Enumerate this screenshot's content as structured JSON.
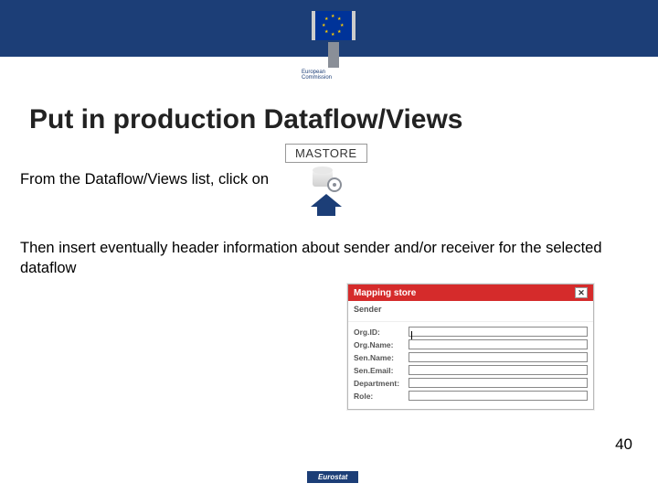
{
  "logo": {
    "line1": "European",
    "line2": "Commission"
  },
  "headline": "Put in production Dataflow/Views",
  "line1": "From the Dataflow/Views list, click on",
  "mastore": {
    "label": "MASTORE"
  },
  "line2": "Then insert eventually header information about sender and/or receiver for the selected dataflow",
  "dialog": {
    "title": "Mapping store",
    "section": "Sender",
    "fields": {
      "orgid": "Org.ID:",
      "orgname": "Org.Name:",
      "senname": "Sen.Name:",
      "senemail": "Sen.Email:",
      "department": "Department:",
      "role": "Role:"
    }
  },
  "page": "40",
  "footer": "Eurostat"
}
